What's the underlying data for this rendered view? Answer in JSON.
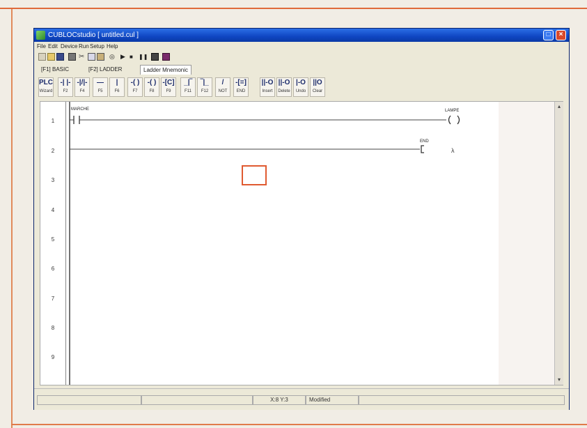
{
  "window": {
    "title": "CUBLOCstudio [ untitled.cul ]"
  },
  "menu": [
    "File",
    "Edit",
    "Device",
    "Run",
    "Setup",
    "Help"
  ],
  "toolbar_icons": [
    "new-file-icon",
    "open-folder-icon",
    "save-icon",
    "print-icon",
    "cut-icon",
    "copy-icon",
    "paste-icon",
    "find-icon",
    "run-icon",
    "stop-icon",
    "pause-icon",
    "monitor-icon",
    "debug-icon"
  ],
  "tabs": [
    {
      "label": "[F1] BASIC"
    },
    {
      "label": "[F2] LADDER"
    },
    {
      "label": "Ladder Mnemonic"
    }
  ],
  "instructions": [
    {
      "symbol": "PLC",
      "key": "Wizard"
    },
    {
      "symbol": "-| |-",
      "key": "F2"
    },
    {
      "symbol": "-|/|-",
      "key": "F4"
    },
    {
      "symbol": "—",
      "key": "F5"
    },
    {
      "symbol": "|",
      "key": "F6"
    },
    {
      "symbol": "-( )",
      "key": "F7"
    },
    {
      "symbol": "-( )",
      "key": "F8"
    },
    {
      "symbol": "-[C]",
      "key": "F9"
    },
    {
      "symbol": "_|‾",
      "key": "F11"
    },
    {
      "symbol": "‾|_",
      "key": "F12"
    },
    {
      "symbol": "/",
      "key": "NOT"
    },
    {
      "symbol": "-[=]",
      "key": "END"
    },
    {
      "symbol": "||-O",
      "key": "Insert"
    },
    {
      "symbol": "||-O",
      "key": "Delete"
    },
    {
      "symbol": "|-O",
      "key": "Undo"
    },
    {
      "symbol": "||O",
      "key": "Clear"
    }
  ],
  "ladder": {
    "rung_numbers": [
      "1",
      "2",
      "3",
      "4",
      "5",
      "6",
      "7",
      "8",
      "9"
    ],
    "rung1": {
      "contact_label": "MARCHE",
      "coil_label": "LAMPE"
    },
    "rung2": {
      "end_label": "END"
    }
  },
  "status": {
    "position": "X:8 Y:3",
    "state": "Modified"
  }
}
